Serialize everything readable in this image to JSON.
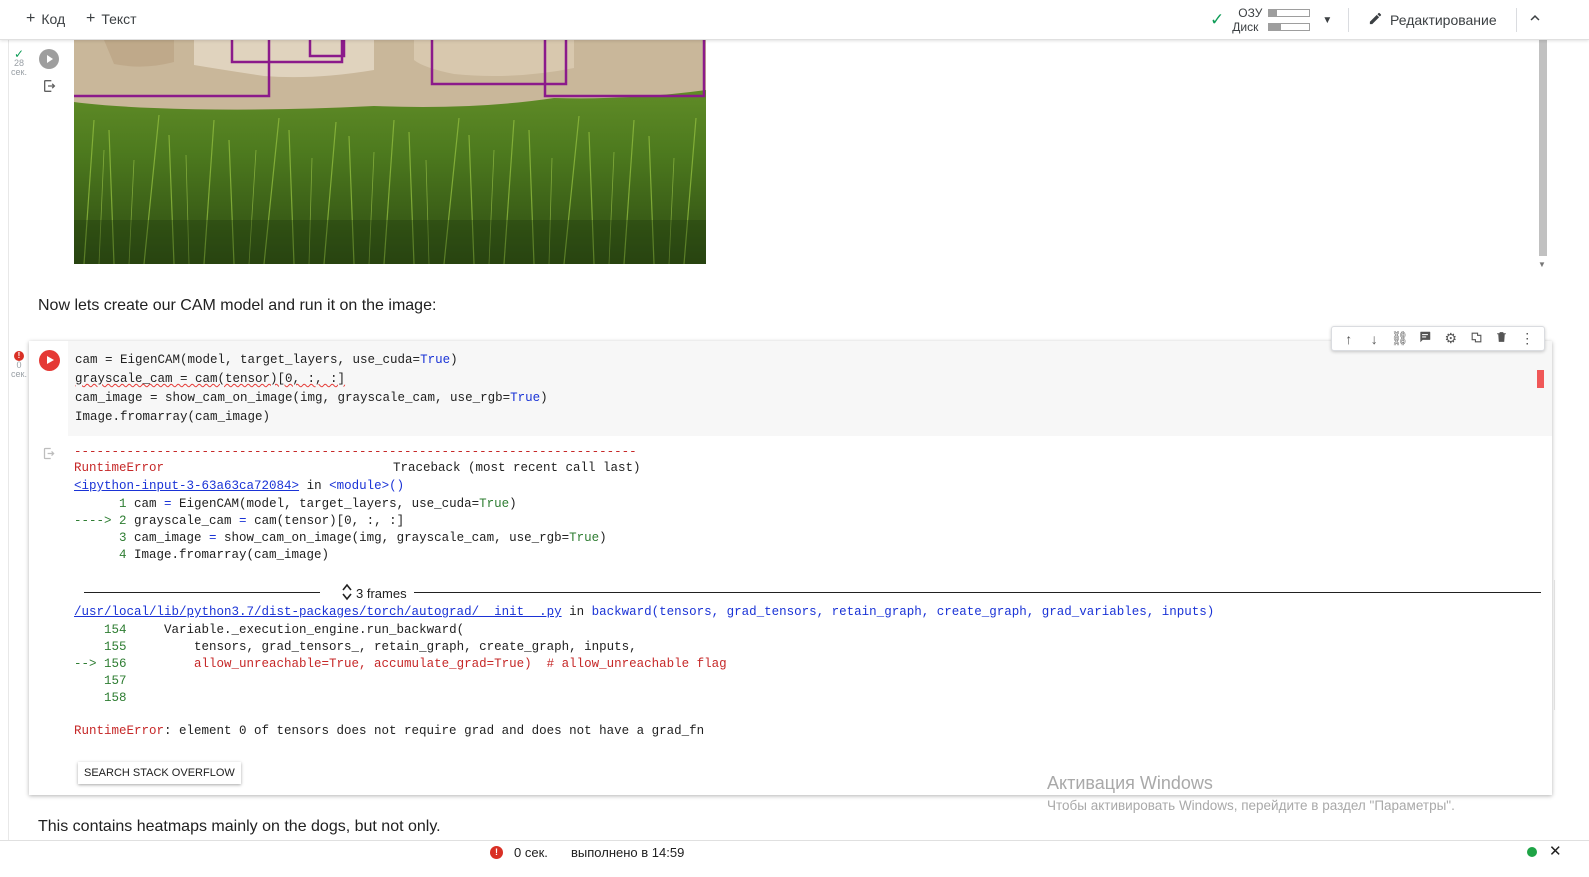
{
  "toolbar": {
    "add_code": "Код",
    "add_text": "Текст",
    "ram_label": "ОЗУ",
    "disk_label": "Диск",
    "ram_usage": 0.2,
    "disk_usage": 0.3,
    "edit_label": "Редактирование"
  },
  "prev_cell": {
    "exec_time": "28",
    "exec_unit": "сек."
  },
  "markdown": {
    "text1": "Now lets create our CAM model and run it on the image:",
    "text2": "This contains heatmaps mainly on the dogs, but not only."
  },
  "cell": {
    "exec_time": "0",
    "exec_unit": "сек.",
    "code_lines": [
      "cam = EigenCAM(model, target_layers, use_cuda=True)",
      "grayscale_cam = cam(tensor)[0, :, :]",
      "cam_image = show_cam_on_image(img, grayscale_cam, use_rgb=True)",
      "Image.fromarray(cam_image)"
    ]
  },
  "traceback": {
    "dashes": "---------------------------------------------------------------------------",
    "error_type": "RuntimeError",
    "header_right": "Traceback (most recent call last)",
    "input_link": "<ipython-input-3-63a63ca72084>",
    "in_word": "in",
    "module": "<module>()",
    "lines1": [
      "      1 cam = EigenCAM(model, target_layers, use_cuda=True)",
      "----> 2 grayscale_cam = cam(tensor)[0, :, :]",
      "      3 cam_image = show_cam_on_image(img, grayscale_cam, use_rgb=True)",
      "      4 Image.fromarray(cam_image)"
    ],
    "frames_label": "3 frames",
    "file_link": "/usr/local/lib/python3.7/dist-packages/torch/autograd/__init__.py",
    "func": "backward(tensors, grad_tensors, retain_graph, create_graph, grad_variables, inputs)",
    "lines2": [
      "    154     Variable._execution_engine.run_backward(",
      "    155         tensors, grad_tensors_, retain_graph, create_graph, inputs,",
      "--> 156         allow_unreachable=True, accumulate_grad=True)  # allow_unreachable flag",
      "    157 ",
      "    158 "
    ],
    "final_type": "RuntimeError",
    "final_msg": ": element 0 of tensors does not require grad and does not have a grad_fn",
    "so_button": "SEARCH STACK OVERFLOW"
  },
  "watermark": {
    "title": "Активация Windows",
    "sub": "Чтобы активировать Windows, перейдите в раздел \"Параметры\"."
  },
  "statusbar": {
    "duration": "0 сек.",
    "completed": "выполнено в 14:59"
  },
  "colors": {
    "accent_red": "#e53935",
    "ok_green": "#0f9d58",
    "link_blue": "#1a33d6"
  }
}
